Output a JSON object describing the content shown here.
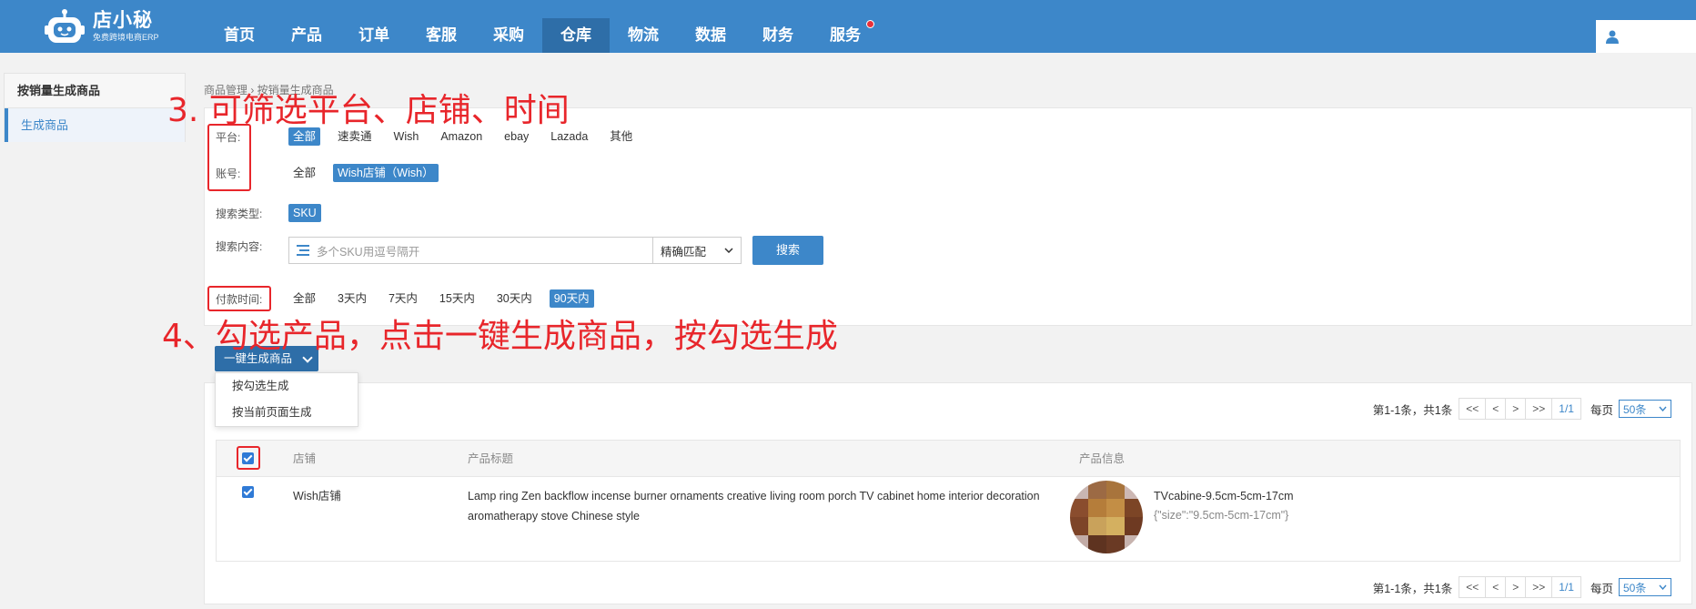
{
  "header": {
    "logo_title": "店小秘",
    "logo_subtitle": "免费跨境电商ERP",
    "nav": [
      {
        "label": "首页"
      },
      {
        "label": "产品"
      },
      {
        "label": "订单"
      },
      {
        "label": "客服"
      },
      {
        "label": "采购"
      },
      {
        "label": "仓库",
        "active": true
      },
      {
        "label": "物流"
      },
      {
        "label": "数据"
      },
      {
        "label": "财务"
      },
      {
        "label": "服务",
        "badge": true
      }
    ]
  },
  "sidebar": {
    "title": "按销量生成商品",
    "items": [
      {
        "label": "生成商品",
        "active": true
      }
    ]
  },
  "breadcrumb": "商品管理 › 按销量生成商品",
  "filters": {
    "platform": {
      "label": "平台:",
      "options": [
        "全部",
        "速卖通",
        "Wish",
        "Amazon",
        "ebay",
        "Lazada",
        "其他"
      ],
      "selected": "全部"
    },
    "account": {
      "label": "账号:",
      "options": [
        "全部",
        "Wish店铺（Wish）"
      ],
      "selected": "Wish店铺（Wish）"
    },
    "search_type": {
      "label": "搜索类型:",
      "options": [
        "SKU"
      ],
      "selected": "SKU"
    },
    "search_content": {
      "label": "搜索内容:",
      "placeholder": "多个SKU用逗号隔开",
      "match_mode": "精确匹配",
      "search_button": "搜索"
    },
    "pay_time": {
      "label": "付款时间:",
      "options": [
        "全部",
        "3天内",
        "7天内",
        "15天内",
        "30天内",
        "90天内"
      ],
      "selected": "90天内"
    }
  },
  "bulk_action": {
    "label": "一键生成商品",
    "menu": [
      "按勾选生成",
      "按当前页面生成"
    ]
  },
  "pagination": {
    "summary": "第1-1条，共1条",
    "first": "<<",
    "prev": "<",
    "next": ">",
    "last": ">>",
    "page": "1/1",
    "per_page_label": "每页",
    "per_page": "50条"
  },
  "table": {
    "columns": [
      "店铺",
      "产品标题",
      "产品信息"
    ],
    "rows": [
      {
        "checked": true,
        "shop": "Wish店铺",
        "title": "Lamp ring Zen backflow incense burner ornaments creative living room porch TV cabinet home interior decoration aromatherapy stove Chinese style",
        "variant_name": "TVcabine-9.5cm-5cm-17cm",
        "variant_attrs": "{\"size\":\"9.5cm-5cm-17cm\"}"
      }
    ]
  },
  "annotations": {
    "step3": "3. 可筛选平台、店铺、时间",
    "step4": "4、勾选产品，点击一键生成商品，按勾选生成"
  },
  "colors": {
    "primary": "#3d87c9",
    "nav_active": "#2e6ea8",
    "annotation_red": "#e8262b"
  }
}
